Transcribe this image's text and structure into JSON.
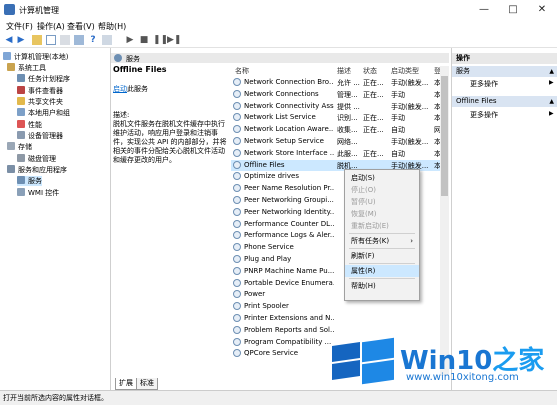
{
  "window": {
    "title": "计算机管理"
  },
  "menubar": [
    "文件(F)",
    "操作(A)",
    "查看(V)",
    "帮助(H)"
  ],
  "tree": [
    {
      "label": "计算机管理(本地)",
      "indent": 0
    },
    {
      "label": "系统工具",
      "indent": 1
    },
    {
      "label": "任务计划程序",
      "indent": 2
    },
    {
      "label": "事件查看器",
      "indent": 2
    },
    {
      "label": "共享文件夹",
      "indent": 2
    },
    {
      "label": "本地用户和组",
      "indent": 2
    },
    {
      "label": "性能",
      "indent": 2
    },
    {
      "label": "设备管理器",
      "indent": 2
    },
    {
      "label": "存储",
      "indent": 1
    },
    {
      "label": "磁盘管理",
      "indent": 2
    },
    {
      "label": "服务和应用程序",
      "indent": 1
    },
    {
      "label": "服务",
      "indent": 2,
      "selected": true
    },
    {
      "label": "WMI 控件",
      "indent": 2
    }
  ],
  "center": {
    "header": "服务",
    "desc_title": "Offline Files",
    "start_link": "启动",
    "start_suffix": "此服务",
    "desc_label": "描述:",
    "desc_text": "脱机文件服务在脱机文件缓存中执行维护活动，响应用户登录和注销事件，实现公共 API 的内部部分，并将相关的事件分配给关心脱机文件活动和缓存更改的用户。"
  },
  "columns": {
    "name": "名称",
    "desc": "描述",
    "status": "状态",
    "startup": "启动类型",
    "logon": "登"
  },
  "services": [
    {
      "name": "Network Connection Bro...",
      "desc": "允许 ...",
      "status": "正在...",
      "startup": "手动(触发...",
      "logon": "本"
    },
    {
      "name": "Network Connections",
      "desc": "管理...",
      "status": "正在...",
      "startup": "手动",
      "logon": "本"
    },
    {
      "name": "Network Connectivity Ass...",
      "desc": "提供 ...",
      "status": "",
      "startup": "手动(触发...",
      "logon": "本"
    },
    {
      "name": "Network List Service",
      "desc": "识别...",
      "status": "正在...",
      "startup": "手动",
      "logon": "本"
    },
    {
      "name": "Network Location Aware...",
      "desc": "收集...",
      "status": "正在...",
      "startup": "自动",
      "logon": "网"
    },
    {
      "name": "Network Setup Service",
      "desc": "网络...",
      "status": "",
      "startup": "手动(触发...",
      "logon": "本"
    },
    {
      "name": "Network Store Interface ...",
      "desc": "此服...",
      "status": "正在...",
      "startup": "自动",
      "logon": "本"
    },
    {
      "name": "Offline Files",
      "desc": "脱机...",
      "status": "",
      "startup": "手动(触发...",
      "logon": "本",
      "selected": true
    },
    {
      "name": "Optimize drives",
      "desc": "",
      "status": "",
      "startup": "",
      "logon": ""
    },
    {
      "name": "Peer Name Resolution Pr...",
      "desc": "",
      "status": "",
      "startup": "",
      "logon": ""
    },
    {
      "name": "Peer Networking Groupi...",
      "desc": "",
      "status": "",
      "startup": "",
      "logon": ""
    },
    {
      "name": "Peer Networking Identity...",
      "desc": "",
      "status": "",
      "startup": "",
      "logon": ""
    },
    {
      "name": "Performance Counter DL...",
      "desc": "",
      "status": "",
      "startup": "",
      "logon": ""
    },
    {
      "name": "Performance Logs & Aler...",
      "desc": "",
      "status": "",
      "startup": "",
      "logon": ""
    },
    {
      "name": "Phone Service",
      "desc": "",
      "status": "",
      "startup": "",
      "logon": ""
    },
    {
      "name": "Plug and Play",
      "desc": "",
      "status": "",
      "startup": "",
      "logon": ""
    },
    {
      "name": "PNRP Machine Name Pu...",
      "desc": "",
      "status": "",
      "startup": "",
      "logon": ""
    },
    {
      "name": "Portable Device Enumera...",
      "desc": "",
      "status": "",
      "startup": "",
      "logon": ""
    },
    {
      "name": "Power",
      "desc": "",
      "status": "",
      "startup": "",
      "logon": ""
    },
    {
      "name": "Print Spooler",
      "desc": "",
      "status": "",
      "startup": "",
      "logon": ""
    },
    {
      "name": "Printer Extensions and N...",
      "desc": "",
      "status": "",
      "startup": "",
      "logon": ""
    },
    {
      "name": "Problem Reports and Sol...",
      "desc": "",
      "status": "",
      "startup": "",
      "logon": ""
    },
    {
      "name": "Program Compatibility ...",
      "desc": "",
      "status": "",
      "startup": "",
      "logon": ""
    },
    {
      "name": "QPCore Service",
      "desc": "",
      "status": "",
      "startup": "",
      "logon": ""
    }
  ],
  "context_menu": [
    {
      "label": "启动(S)",
      "enabled": true
    },
    {
      "label": "停止(O)",
      "enabled": false
    },
    {
      "label": "暂停(U)",
      "enabled": false
    },
    {
      "label": "恢复(M)",
      "enabled": false
    },
    {
      "label": "重新启动(E)",
      "enabled": false
    },
    {
      "sep": true
    },
    {
      "label": "所有任务(K)",
      "enabled": true,
      "submenu": true
    },
    {
      "sep": true
    },
    {
      "label": "刷新(F)",
      "enabled": true
    },
    {
      "sep": true
    },
    {
      "label": "属性(R)",
      "enabled": true,
      "highlight": true
    },
    {
      "sep": true
    },
    {
      "label": "帮助(H)",
      "enabled": true
    }
  ],
  "tabs": [
    "扩展",
    "标准"
  ],
  "actions": {
    "title": "操作",
    "groups": [
      {
        "header": "服务",
        "items": [
          "更多操作"
        ]
      },
      {
        "header": "Offline Files",
        "items": [
          "更多操作"
        ]
      }
    ]
  },
  "statusbar": "打开当前所选内容的属性对话框。",
  "watermark": {
    "brand": "Win10",
    "brand_suffix": "之家",
    "url": "www.win10xitong.com"
  },
  "colors": {
    "selection": "#cce8ff",
    "link": "#0066cc",
    "logo_blue": "#1976d2"
  }
}
